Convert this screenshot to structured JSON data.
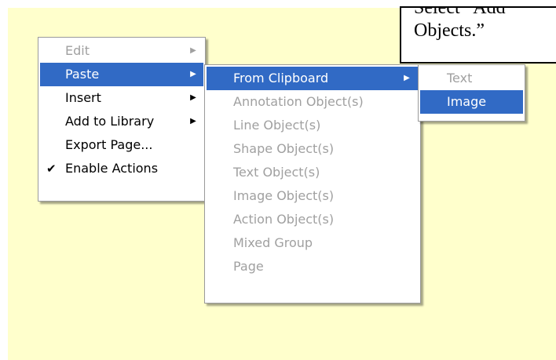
{
  "callout": {
    "line1": "Select “Add",
    "line2": "Objects.”"
  },
  "context_menu": {
    "items": [
      {
        "label": "Edit",
        "has_submenu": true,
        "disabled": true
      },
      {
        "label": "Paste",
        "has_submenu": true,
        "highlighted": true
      },
      {
        "label": "Insert",
        "has_submenu": true
      },
      {
        "label": "Add to Library",
        "has_submenu": true
      },
      {
        "label": "Export Page..."
      },
      {
        "label": "Enable Actions",
        "checked": true
      }
    ]
  },
  "paste_submenu": {
    "items": [
      {
        "label": "From Clipboard",
        "has_submenu": true,
        "highlighted": true
      },
      {
        "label": "Annotation Object(s)",
        "disabled": true
      },
      {
        "label": "Line Object(s)",
        "disabled": true
      },
      {
        "label": "Shape Object(s)",
        "disabled": true
      },
      {
        "label": "Text Object(s)",
        "disabled": true
      },
      {
        "label": "Image Object(s)",
        "disabled": true
      },
      {
        "label": "Action Object(s)",
        "disabled": true
      },
      {
        "label": "Mixed Group",
        "disabled": true
      },
      {
        "label": "Page",
        "disabled": true
      }
    ]
  },
  "clipboard_submenu": {
    "items": [
      {
        "label": "Text",
        "disabled": true
      },
      {
        "label": "Image",
        "highlighted": true
      }
    ]
  },
  "colors": {
    "canvas_background": "#ffffcc",
    "highlight": "#316ac5",
    "disabled_text": "#a0a0a0"
  }
}
